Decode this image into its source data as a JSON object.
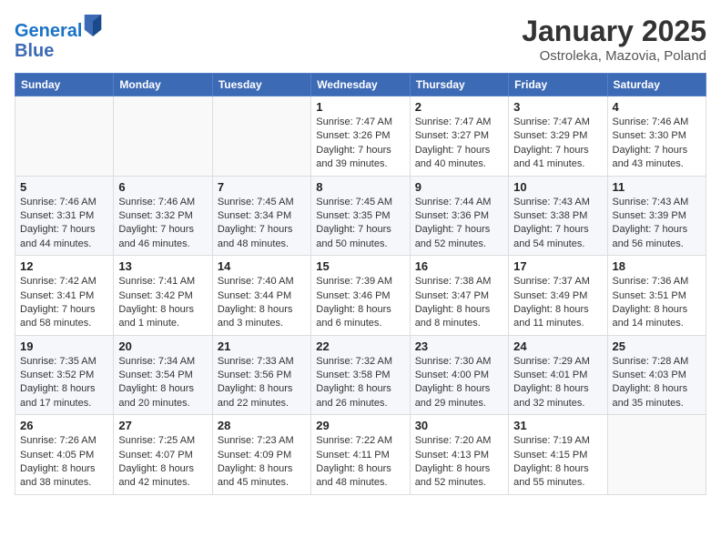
{
  "logo": {
    "line1": "General",
    "line2": "Blue"
  },
  "title": "January 2025",
  "subtitle": "Ostroleka, Mazovia, Poland",
  "headers": [
    "Sunday",
    "Monday",
    "Tuesday",
    "Wednesday",
    "Thursday",
    "Friday",
    "Saturday"
  ],
  "weeks": [
    [
      {
        "day": "",
        "info": ""
      },
      {
        "day": "",
        "info": ""
      },
      {
        "day": "",
        "info": ""
      },
      {
        "day": "1",
        "info": "Sunrise: 7:47 AM\nSunset: 3:26 PM\nDaylight: 7 hours\nand 39 minutes."
      },
      {
        "day": "2",
        "info": "Sunrise: 7:47 AM\nSunset: 3:27 PM\nDaylight: 7 hours\nand 40 minutes."
      },
      {
        "day": "3",
        "info": "Sunrise: 7:47 AM\nSunset: 3:29 PM\nDaylight: 7 hours\nand 41 minutes."
      },
      {
        "day": "4",
        "info": "Sunrise: 7:46 AM\nSunset: 3:30 PM\nDaylight: 7 hours\nand 43 minutes."
      }
    ],
    [
      {
        "day": "5",
        "info": "Sunrise: 7:46 AM\nSunset: 3:31 PM\nDaylight: 7 hours\nand 44 minutes."
      },
      {
        "day": "6",
        "info": "Sunrise: 7:46 AM\nSunset: 3:32 PM\nDaylight: 7 hours\nand 46 minutes."
      },
      {
        "day": "7",
        "info": "Sunrise: 7:45 AM\nSunset: 3:34 PM\nDaylight: 7 hours\nand 48 minutes."
      },
      {
        "day": "8",
        "info": "Sunrise: 7:45 AM\nSunset: 3:35 PM\nDaylight: 7 hours\nand 50 minutes."
      },
      {
        "day": "9",
        "info": "Sunrise: 7:44 AM\nSunset: 3:36 PM\nDaylight: 7 hours\nand 52 minutes."
      },
      {
        "day": "10",
        "info": "Sunrise: 7:43 AM\nSunset: 3:38 PM\nDaylight: 7 hours\nand 54 minutes."
      },
      {
        "day": "11",
        "info": "Sunrise: 7:43 AM\nSunset: 3:39 PM\nDaylight: 7 hours\nand 56 minutes."
      }
    ],
    [
      {
        "day": "12",
        "info": "Sunrise: 7:42 AM\nSunset: 3:41 PM\nDaylight: 7 hours\nand 58 minutes."
      },
      {
        "day": "13",
        "info": "Sunrise: 7:41 AM\nSunset: 3:42 PM\nDaylight: 8 hours\nand 1 minute."
      },
      {
        "day": "14",
        "info": "Sunrise: 7:40 AM\nSunset: 3:44 PM\nDaylight: 8 hours\nand 3 minutes."
      },
      {
        "day": "15",
        "info": "Sunrise: 7:39 AM\nSunset: 3:46 PM\nDaylight: 8 hours\nand 6 minutes."
      },
      {
        "day": "16",
        "info": "Sunrise: 7:38 AM\nSunset: 3:47 PM\nDaylight: 8 hours\nand 8 minutes."
      },
      {
        "day": "17",
        "info": "Sunrise: 7:37 AM\nSunset: 3:49 PM\nDaylight: 8 hours\nand 11 minutes."
      },
      {
        "day": "18",
        "info": "Sunrise: 7:36 AM\nSunset: 3:51 PM\nDaylight: 8 hours\nand 14 minutes."
      }
    ],
    [
      {
        "day": "19",
        "info": "Sunrise: 7:35 AM\nSunset: 3:52 PM\nDaylight: 8 hours\nand 17 minutes."
      },
      {
        "day": "20",
        "info": "Sunrise: 7:34 AM\nSunset: 3:54 PM\nDaylight: 8 hours\nand 20 minutes."
      },
      {
        "day": "21",
        "info": "Sunrise: 7:33 AM\nSunset: 3:56 PM\nDaylight: 8 hours\nand 22 minutes."
      },
      {
        "day": "22",
        "info": "Sunrise: 7:32 AM\nSunset: 3:58 PM\nDaylight: 8 hours\nand 26 minutes."
      },
      {
        "day": "23",
        "info": "Sunrise: 7:30 AM\nSunset: 4:00 PM\nDaylight: 8 hours\nand 29 minutes."
      },
      {
        "day": "24",
        "info": "Sunrise: 7:29 AM\nSunset: 4:01 PM\nDaylight: 8 hours\nand 32 minutes."
      },
      {
        "day": "25",
        "info": "Sunrise: 7:28 AM\nSunset: 4:03 PM\nDaylight: 8 hours\nand 35 minutes."
      }
    ],
    [
      {
        "day": "26",
        "info": "Sunrise: 7:26 AM\nSunset: 4:05 PM\nDaylight: 8 hours\nand 38 minutes."
      },
      {
        "day": "27",
        "info": "Sunrise: 7:25 AM\nSunset: 4:07 PM\nDaylight: 8 hours\nand 42 minutes."
      },
      {
        "day": "28",
        "info": "Sunrise: 7:23 AM\nSunset: 4:09 PM\nDaylight: 8 hours\nand 45 minutes."
      },
      {
        "day": "29",
        "info": "Sunrise: 7:22 AM\nSunset: 4:11 PM\nDaylight: 8 hours\nand 48 minutes."
      },
      {
        "day": "30",
        "info": "Sunrise: 7:20 AM\nSunset: 4:13 PM\nDaylight: 8 hours\nand 52 minutes."
      },
      {
        "day": "31",
        "info": "Sunrise: 7:19 AM\nSunset: 4:15 PM\nDaylight: 8 hours\nand 55 minutes."
      },
      {
        "day": "",
        "info": ""
      }
    ]
  ]
}
